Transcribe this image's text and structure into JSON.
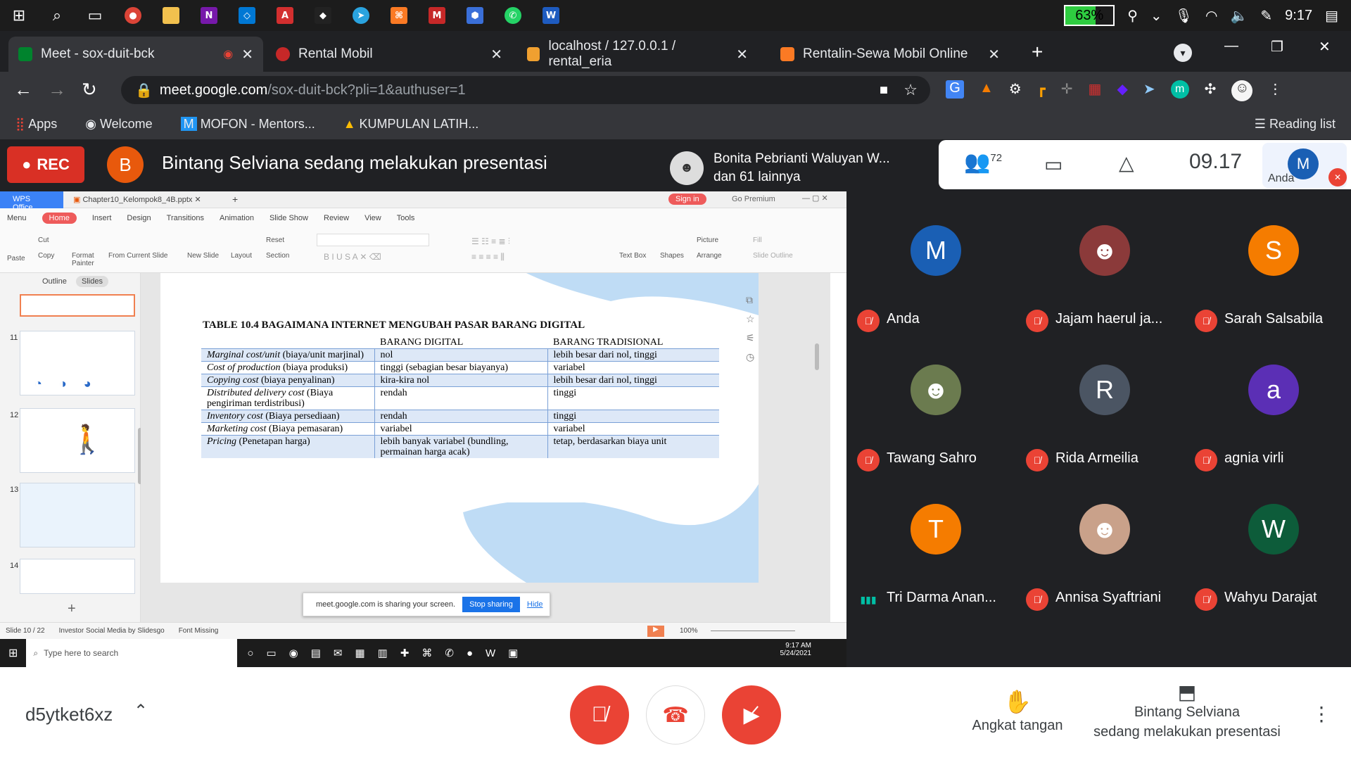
{
  "taskbar": {
    "battery": "63%",
    "time": "9:17"
  },
  "tabs": [
    {
      "label": "Meet - sox-duit-bck"
    },
    {
      "label": "Rental Mobil"
    },
    {
      "label": "localhost / 127.0.0.1 / rental_eria"
    },
    {
      "label": "Rentalin-Sewa Mobil Online"
    }
  ],
  "omnibox": {
    "host": "meet.google.com",
    "path": "/sox-duit-bck?pli=1&authuser=1"
  },
  "bookmarks": [
    "Apps",
    "Welcome",
    "MOFON - Mentors...",
    "KUMPULAN LATIH..."
  ],
  "reading_list": "Reading list",
  "meet": {
    "rec": "REC",
    "presenter_initial": "B",
    "presenting_title": "Bintang Selviana sedang melakukan presentasi",
    "pinned_name": "Bonita Pebrianti Waluyan W...",
    "pinned_sub": "dan 61 lainnya",
    "people_count": "72",
    "clock": "09.17",
    "self_label": "Anda",
    "self_initial": "M"
  },
  "wps": {
    "app": "WPS Office",
    "file": "Chapter10_Kelompok8_4B.pptx",
    "sign_in": "Sign in",
    "go_premium": "Go Premium",
    "menu": [
      "Menu",
      "Home",
      "Insert",
      "Design",
      "Transitions",
      "Animation",
      "Slide Show",
      "Review",
      "View",
      "Tools"
    ],
    "ribbon": [
      "Paste",
      "Cut",
      "Copy",
      "Format Painter",
      "From Current Slide",
      "New Slide",
      "Layout",
      "Reset",
      "Section",
      "Text Box",
      "Shapes",
      "Arrange",
      "Picture",
      "Fill",
      "Slide Outline"
    ],
    "panel_tabs": [
      "Outline",
      "Slides"
    ],
    "slide_numbers": [
      "11",
      "12",
      "13",
      "14"
    ],
    "status": [
      "Slide 10 / 22",
      "Investor Social Media by Slidesgo",
      "Font Missing"
    ],
    "zoom": "100%",
    "share_msg": "meet.google.com is sharing your screen.",
    "stop_sharing": "Stop sharing",
    "hide": "Hide",
    "taskbar_search": "Type here to search",
    "taskbar_time": "9:17 AM",
    "taskbar_date": "5/24/2021"
  },
  "slide": {
    "title": "TABLE 10.4 BAGAIMANA INTERNET MENGUBAH PASAR BARANG DIGITAL",
    "headers": [
      "",
      "BARANG DIGITAL",
      "BARANG TRADISIONAL"
    ],
    "rows": [
      {
        "en": "Marginal cost/unit",
        "id": " (biaya/unit marjinal)",
        "digital": "nol",
        "trad": "lebih besar dari nol, tinggi"
      },
      {
        "en": "Cost of production",
        "id": " (biaya produksi)",
        "digital": "tinggi (sebagian besar biayanya)",
        "trad": "variabel"
      },
      {
        "en": "Copying cost",
        "id": " (biaya penyalinan)",
        "digital": "kira-kira nol",
        "trad": "lebih besar dari nol, tinggi"
      },
      {
        "en": "Distributed delivery cost",
        "id": " (Biaya pengiriman terdistribusi)",
        "digital": "rendah",
        "trad": "tinggi"
      },
      {
        "en": "Inventory cost",
        "id": " (Biaya persediaan)",
        "digital": "rendah",
        "trad": "tinggi"
      },
      {
        "en": "Marketing cost",
        "id": " (Biaya pemasaran)",
        "digital": "variabel",
        "trad": "variabel"
      },
      {
        "en": "Pricing",
        "id": " (Penetapan harga)",
        "digital": "lebih banyak variabel (bundling, permainan harga acak)",
        "trad": "tetap, berdasarkan biaya unit"
      }
    ]
  },
  "participants": [
    {
      "name": "Anda",
      "initial": "M",
      "color": "#1a5fb4"
    },
    {
      "name": "Jajam haerul ja...",
      "initial": "",
      "color": "#8b3a3a"
    },
    {
      "name": "Sarah Salsabila",
      "initial": "S",
      "color": "#f57c00"
    },
    {
      "name": "Tawang Sahro",
      "initial": "",
      "color": "#6b7b4f"
    },
    {
      "name": "Rida Armeilia",
      "initial": "R",
      "color": "#4b5563"
    },
    {
      "name": "agnia virli",
      "initial": "a",
      "color": "#5b2fb5"
    },
    {
      "name": "Tri Darma Anan...",
      "initial": "T",
      "color": "#f57c00"
    },
    {
      "name": "Annisa Syaftriani",
      "initial": "",
      "color": "#c9a18a"
    },
    {
      "name": "Wahyu Darajat",
      "initial": "W",
      "color": "#0d5c3a"
    }
  ],
  "bottom": {
    "meeting_code": "d5ytket6xz",
    "raise_hand": "Angkat tangan",
    "presenting_line1": "Bintang Selviana",
    "presenting_line2": "sedang melakukan presentasi"
  },
  "colors": {
    "accent_red": "#ea4335",
    "meet_dark": "#202124"
  }
}
